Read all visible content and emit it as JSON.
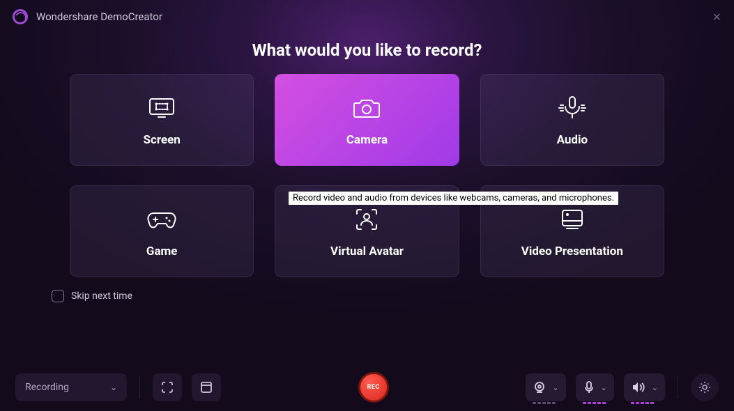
{
  "app": {
    "title": "Wondershare DemoCreator"
  },
  "main": {
    "heading": "What would you like to record?",
    "cards": [
      {
        "label": "Screen"
      },
      {
        "label": "Camera"
      },
      {
        "label": "Audio"
      },
      {
        "label": "Game"
      },
      {
        "label": "Virtual Avatar"
      },
      {
        "label": "Video Presentation"
      }
    ],
    "tooltip": "Record video and audio from devices like webcams, cameras, and microphones."
  },
  "skip": {
    "label": "Skip next time"
  },
  "bottom": {
    "mode": "Recording",
    "rec": "REC"
  }
}
